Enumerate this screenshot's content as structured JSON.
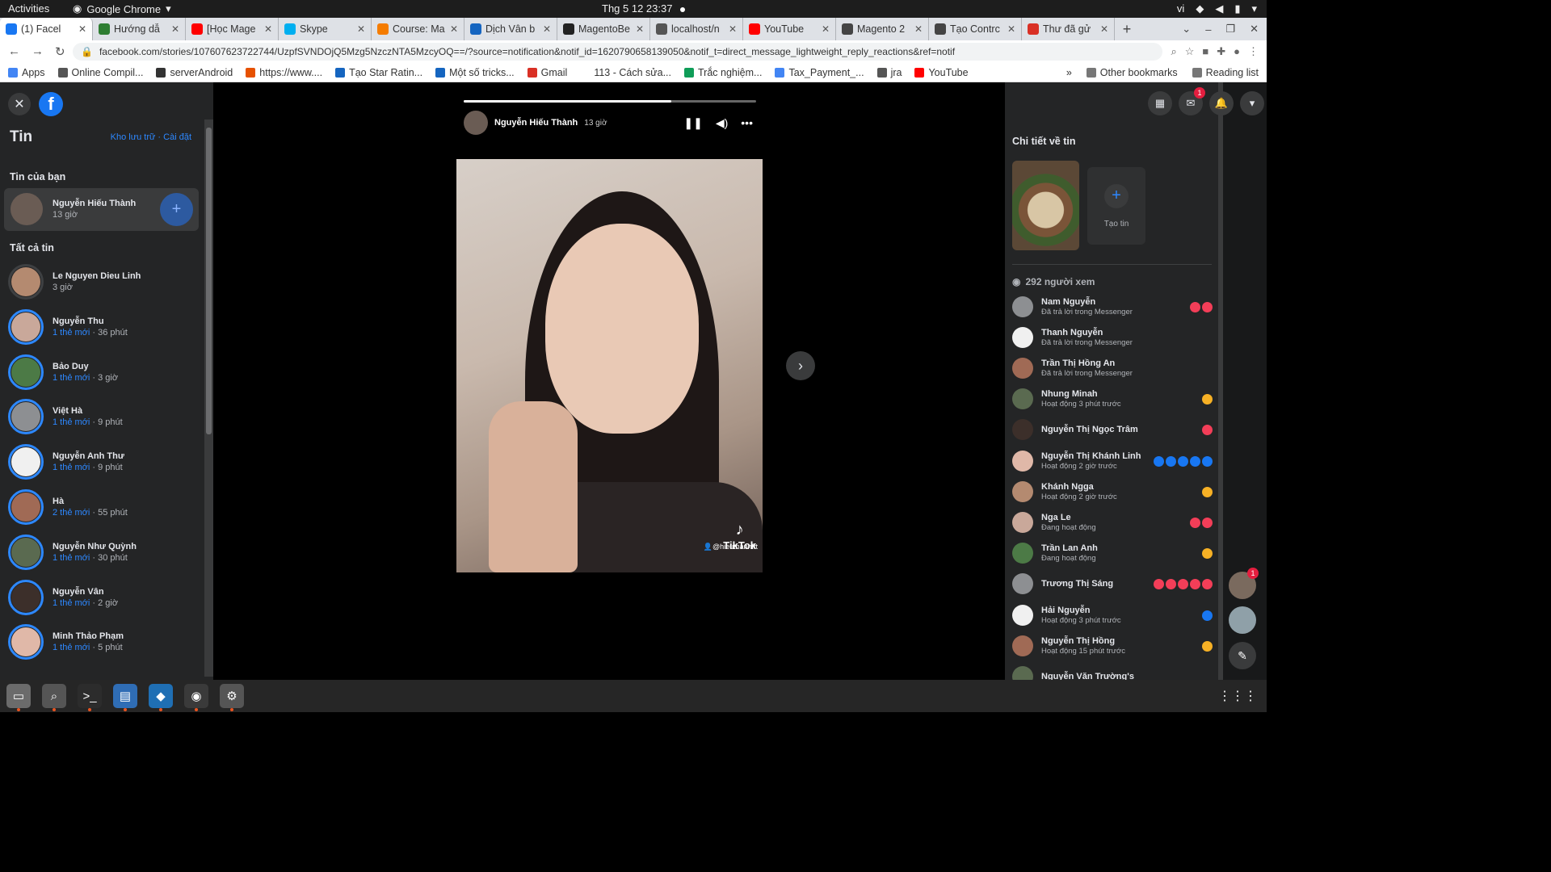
{
  "system": {
    "activities": "Activities",
    "app_name": "Google Chrome",
    "clock": "Thg 5 12  23:37",
    "lang": "vi"
  },
  "tabs": [
    {
      "title": "(1) Facel",
      "color": "#1877f2",
      "active": true
    },
    {
      "title": "Hướng dẫ",
      "color": "#2e7d32"
    },
    {
      "title": "[Học Mage",
      "color": "#ff0000"
    },
    {
      "title": "Skype",
      "color": "#00aff0"
    },
    {
      "title": "Course: Ma",
      "color": "#f57c00"
    },
    {
      "title": "Dịch Vân b",
      "color": "#1565c0"
    },
    {
      "title": "MagentoBe",
      "color": "#222"
    },
    {
      "title": "localhost/n",
      "color": "#555"
    },
    {
      "title": "YouTube",
      "color": "#ff0000"
    },
    {
      "title": "Magento 2",
      "color": "#444"
    },
    {
      "title": "Tạo Contrc",
      "color": "#444"
    },
    {
      "title": "Thư đã gử",
      "color": "#d93025"
    }
  ],
  "address": {
    "url": "facebook.com/stories/107607623722744/UzpfSVNDOjQ5Mzg5NzczNTA5MzcyOQ==/?source=notification&notif_id=1620790658139050&notif_t=direct_message_lightweight_reply_reactions&ref=notif"
  },
  "bookmarks": [
    {
      "label": "Apps",
      "color": "#4285f4"
    },
    {
      "label": "Online Compil...",
      "color": "#555"
    },
    {
      "label": "serverAndroid",
      "color": "#333"
    },
    {
      "label": "https://www....",
      "color": "#e65100"
    },
    {
      "label": "Tạo Star Ratin...",
      "color": "#1565c0"
    },
    {
      "label": "Một số tricks...",
      "color": "#1565c0"
    },
    {
      "label": "Gmail",
      "color": "#d93025"
    },
    {
      "label": "113 - Cách sửa...",
      "color": "#fff"
    },
    {
      "label": "Trắc nghiệm...",
      "color": "#0f9d58"
    },
    {
      "label": "Tax_Payment_...",
      "color": "#4285f4"
    },
    {
      "label": "jra",
      "color": "#555"
    },
    {
      "label": "YouTube",
      "color": "#ff0000"
    }
  ],
  "bookmarks_right": {
    "other": "Other bookmarks",
    "reading": "Reading list"
  },
  "left": {
    "title": "Tin",
    "archive": "Kho lưu trữ",
    "settings": "Cài đặt",
    "your_story_label": "Tin của bạn",
    "your_story": {
      "name": "Nguyễn Hiếu Thành",
      "time": "13 giờ"
    },
    "all_label": "Tất cả tin",
    "stories": [
      {
        "name": "Le Nguyen Dieu Linh",
        "new": "",
        "time": "3 giờ"
      },
      {
        "name": "Nguyễn Thu",
        "new": "1 thẻ mới",
        "time": "36 phút"
      },
      {
        "name": "Bảo Duy",
        "new": "1 thẻ mới",
        "time": "3 giờ"
      },
      {
        "name": "Việt Hà",
        "new": "1 thẻ mới",
        "time": "9 phút"
      },
      {
        "name": "Nguyễn Anh Thư",
        "new": "1 thẻ mới",
        "time": "9 phút"
      },
      {
        "name": "Hà",
        "new": "2 thẻ mới",
        "time": "55 phút"
      },
      {
        "name": "Nguyễn Như Quỳnh",
        "new": "1 thẻ mới",
        "time": "30 phút"
      },
      {
        "name": "Nguyễn Vân",
        "new": "1 thẻ mới",
        "time": "2 giờ"
      },
      {
        "name": "Minh Thảo Phạm",
        "new": "1 thẻ mới",
        "time": "5 phút"
      }
    ]
  },
  "story": {
    "author": "Nguyễn Hiếu Thành",
    "time": "13 giờ",
    "progress": 0.71,
    "watermark": "TikTok",
    "handle": "@hieuthanhfft"
  },
  "right": {
    "title": "Chi tiết về tin",
    "create_label": "Tạo tin",
    "viewers_count": "292 người xem",
    "viewers": [
      {
        "name": "Nam Nguyễn",
        "status": "Đã trả lời trong Messenger",
        "reactions": [
          "heart",
          "heart"
        ]
      },
      {
        "name": "Thanh Nguyễn",
        "status": "Đã trả lời trong Messenger",
        "reactions": []
      },
      {
        "name": "Trần Thị Hồng An",
        "status": "Đã trả lời trong Messenger",
        "reactions": []
      },
      {
        "name": "Nhung Minah",
        "status": "Hoạt động 3 phút trước",
        "reactions": [
          "haha"
        ]
      },
      {
        "name": "Nguyễn Thị Ngọc Trâm",
        "status": "",
        "reactions": [
          "heart"
        ]
      },
      {
        "name": "Nguyễn Thị Khánh Linh",
        "status": "Hoạt động 2 giờ trước",
        "reactions": [
          "like",
          "like",
          "like",
          "like",
          "like"
        ]
      },
      {
        "name": "Khánh Ngga",
        "status": "Hoạt động 2 giờ trước",
        "reactions": [
          "haha"
        ]
      },
      {
        "name": "Nga Le",
        "status": "Đang hoạt động",
        "reactions": [
          "heart",
          "heart"
        ]
      },
      {
        "name": "Trần Lan Anh",
        "status": "Đang hoạt động",
        "reactions": [
          "haha"
        ]
      },
      {
        "name": "Trương Thị Sáng",
        "status": "",
        "reactions": [
          "heart",
          "heart",
          "heart",
          "heart",
          "heart"
        ]
      },
      {
        "name": "Hải Nguyễn",
        "status": "Hoạt động 3 phút trước",
        "reactions": [
          "like"
        ]
      },
      {
        "name": "Nguyễn Thị Hồng",
        "status": "Hoạt động 15 phút trước",
        "reactions": [
          "haha"
        ]
      },
      {
        "name": "Nguyễn Văn Trường's",
        "status": "",
        "reactions": []
      }
    ]
  },
  "badges": {
    "messenger": "1",
    "chat": "1"
  },
  "taskbar": [
    "files-icon",
    "image-viewer-icon",
    "terminal-icon",
    "document-icon",
    "vscode-icon",
    "chrome-icon",
    "settings-icon"
  ]
}
